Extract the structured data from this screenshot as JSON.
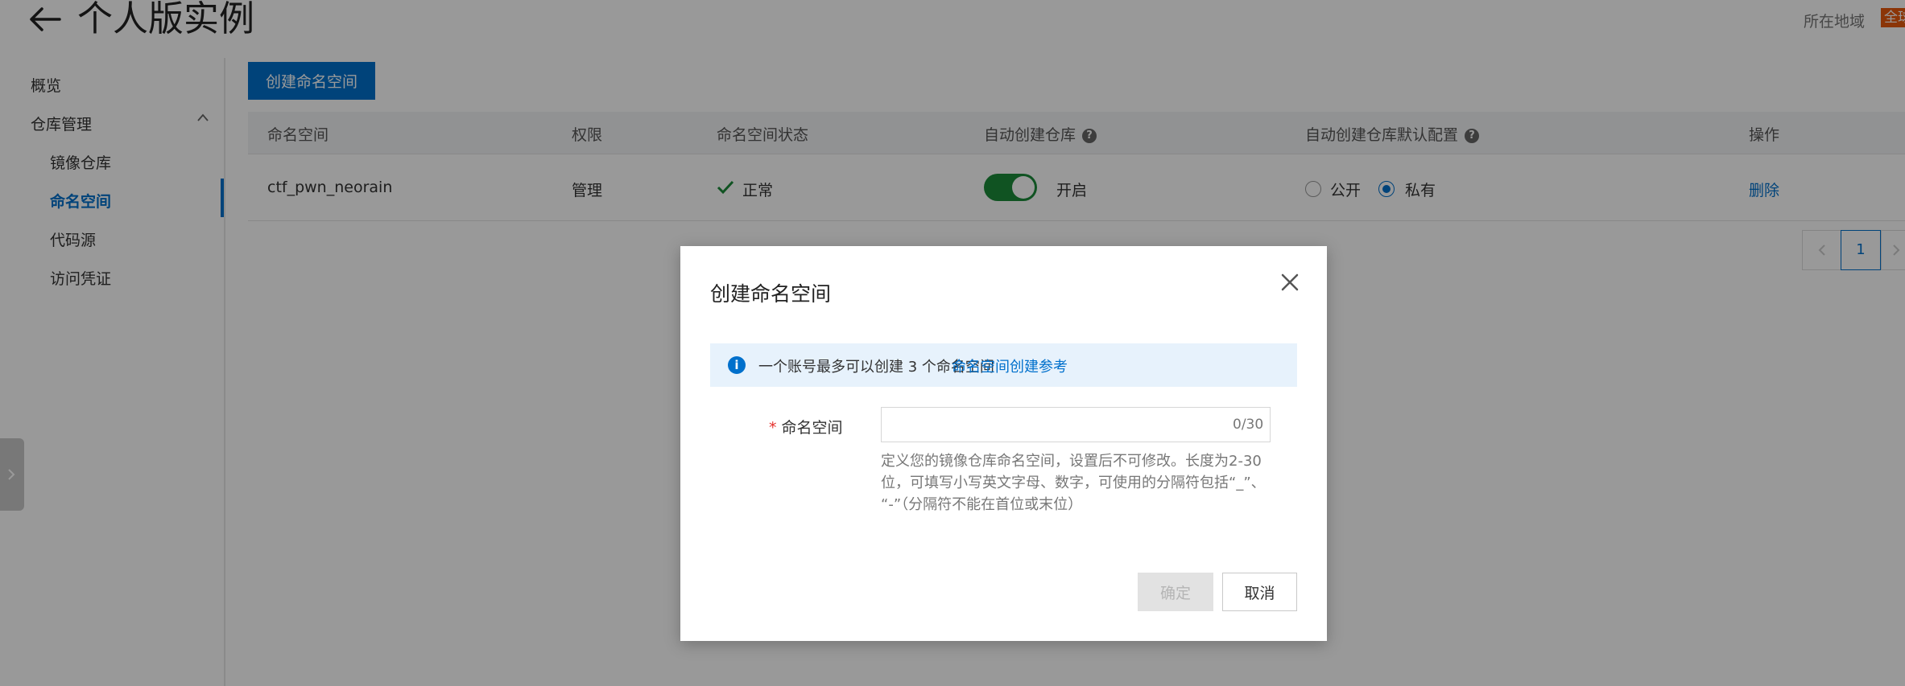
{
  "header": {
    "title": "个人版实例",
    "back_icon": "arrow-left-icon",
    "region_label": "所在地域",
    "region_value": "全球"
  },
  "sidebar": {
    "items": [
      {
        "label": "概览"
      },
      {
        "label": "仓库管理"
      },
      {
        "label": "镜像仓库"
      },
      {
        "label": "命名空间"
      },
      {
        "label": "代码源"
      },
      {
        "label": "访问凭证"
      }
    ],
    "active_item": "命名空间"
  },
  "main": {
    "create_button": "创建命名空间",
    "table": {
      "headers": [
        "命名空间",
        "权限",
        "命名空间状态",
        "自动创建仓库",
        "自动创建仓库默认配置",
        "操作"
      ],
      "rows": [
        {
          "namespace": "ctf_pwn_neorain",
          "permission": "管理",
          "status": "正常",
          "auto_create": "开启",
          "auto_create_on": true,
          "default_options": [
            "公开",
            "私有"
          ],
          "default_selected": "私有",
          "action": "删除"
        }
      ]
    },
    "pagination": {
      "current_page": "1"
    }
  },
  "dialog": {
    "title": "创建命名空间",
    "notice_text": "一个账号最多可以创建 3 个命名空间",
    "notice_link": "命名空间创建参考",
    "field_label": "命名空间",
    "input_value": "",
    "input_counter": "0/30",
    "help_lines": [
      "定义您的镜像仓库命名空间，设置后不可修改。长度为2-30",
      "位，可填写小写英文字母、数字，可使用的分隔符包括“_”、",
      "“-”（分隔符不能在首位或末位）"
    ],
    "ok_label": "确定",
    "ok_disabled": true,
    "cancel_label": "取消"
  },
  "colors": {
    "accent": "#0070cc",
    "toggle_on": "#1c8a3a",
    "status_ok": "#1c8a3a",
    "required": "#e5302c",
    "overlay": "rgba(0,0,0,0.40)"
  }
}
